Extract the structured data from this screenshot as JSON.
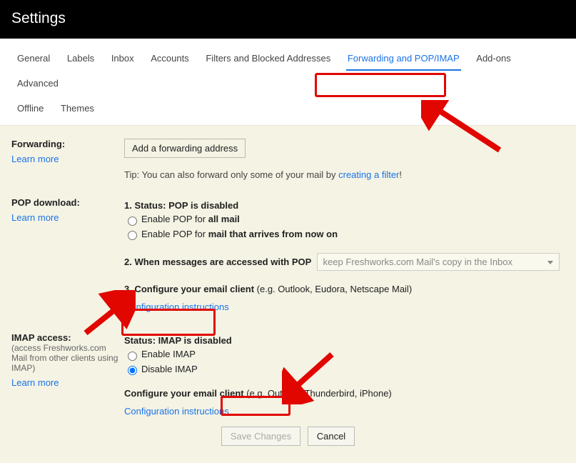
{
  "header": {
    "title": "Settings"
  },
  "tabs": {
    "items": [
      {
        "label": "General"
      },
      {
        "label": "Labels"
      },
      {
        "label": "Inbox"
      },
      {
        "label": "Accounts"
      },
      {
        "label": "Filters and Blocked Addresses"
      },
      {
        "label": "Forwarding and POP/IMAP",
        "active": true
      },
      {
        "label": "Add-ons"
      },
      {
        "label": "Advanced"
      },
      {
        "label": "Offline"
      },
      {
        "label": "Themes"
      }
    ]
  },
  "learn_more": "Learn more",
  "forwarding": {
    "label": "Forwarding:",
    "button": "Add a forwarding address",
    "tip_prefix": "Tip: You can also forward only some of your mail by ",
    "tip_link": "creating a filter",
    "tip_suffix": "!"
  },
  "pop": {
    "label": "POP download:",
    "status_prefix": "1. Status: ",
    "status_bold": "POP is disabled",
    "opt1_prefix": "Enable POP for ",
    "opt1_bold": "all mail",
    "opt2_prefix": "Enable POP for ",
    "opt2_bold": "mail that arrives from now on",
    "q2": "2. When messages are accessed with POP",
    "select_value": "keep Freshworks.com Mail's copy in the Inbox",
    "q3_bold": "3. Configure your email client",
    "q3_rest": " (e.g. Outlook, Eudora, Netscape Mail)",
    "config_link": "Configuration instructions"
  },
  "imap": {
    "label": "IMAP access:",
    "sub1": "(access Freshworks.com",
    "sub2": "Mail from other clients using",
    "sub3": "IMAP)",
    "status": "Status: IMAP is disabled",
    "enable": "Enable IMAP",
    "disable": "Disable IMAP",
    "cfg_bold": "Configure your email client",
    "cfg_rest": " (e.g. Outlook, Thunderbird, iPhone)",
    "config_link": "Configuration instructions"
  },
  "footer": {
    "save": "Save Changes",
    "cancel": "Cancel"
  }
}
